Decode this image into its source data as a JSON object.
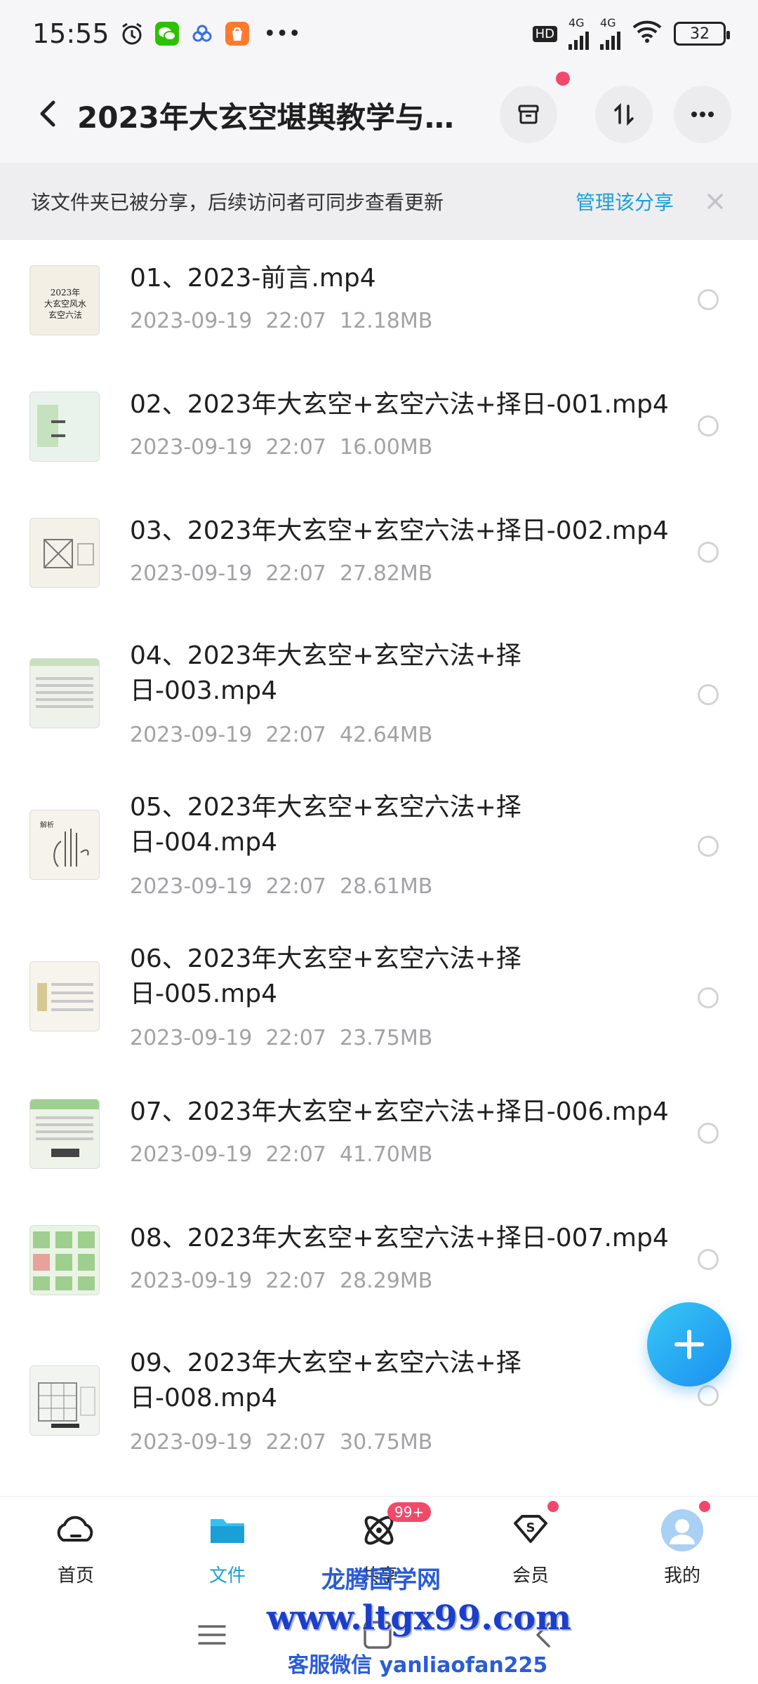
{
  "status": {
    "time": "15:55",
    "net1": "4G",
    "net2": "4G",
    "hd": "HD",
    "battery": "32",
    "more": "•••"
  },
  "header": {
    "title": "2023年大玄空堪舆教学与...",
    "icons": [
      "back-icon",
      "archive-icon",
      "sort-icon",
      "more-icon"
    ]
  },
  "banner": {
    "text": "该文件夹已被分享，后续访问者可同步查看更新",
    "manage": "管理该分享"
  },
  "files": [
    {
      "name": "01、2023-前言.mp4",
      "date": "2023-09-19",
      "time": "22:07",
      "size": "12.18MB"
    },
    {
      "name": "02、2023年大玄空+玄空六法+择日-001.mp4",
      "date": "2023-09-19",
      "time": "22:07",
      "size": "16.00MB"
    },
    {
      "name": "03、2023年大玄空+玄空六法+择日-002.mp4",
      "date": "2023-09-19",
      "time": "22:07",
      "size": "27.82MB"
    },
    {
      "name": "04、2023年大玄空+玄空六法+择日-003.mp4",
      "date": "2023-09-19",
      "time": "22:07",
      "size": "42.64MB"
    },
    {
      "name": "05、2023年大玄空+玄空六法+择日-004.mp4",
      "date": "2023-09-19",
      "time": "22:07",
      "size": "28.61MB"
    },
    {
      "name": "06、2023年大玄空+玄空六法+择日-005.mp4",
      "date": "2023-09-19",
      "time": "22:07",
      "size": "23.75MB"
    },
    {
      "name": "07、2023年大玄空+玄空六法+择日-006.mp4",
      "date": "2023-09-19",
      "time": "22:07",
      "size": "41.70MB"
    },
    {
      "name": "08、2023年大玄空+玄空六法+择日-007.mp4",
      "date": "2023-09-19",
      "time": "22:07",
      "size": "28.29MB"
    },
    {
      "name": "09、2023年大玄空+玄空六法+择日-008.mp4",
      "date": "2023-09-19",
      "time": "22:07",
      "size": "30.75MB"
    }
  ],
  "tabs": [
    {
      "label": "首页",
      "icon": "home-icon"
    },
    {
      "label": "文件",
      "icon": "folder-icon"
    },
    {
      "label": "共享",
      "icon": "share-icon",
      "badge": "99+"
    },
    {
      "label": "会员",
      "icon": "vip-icon"
    },
    {
      "label": "我的",
      "icon": "avatar-icon"
    }
  ],
  "watermark": {
    "line1": "龙腾国学网",
    "line2": "www.ltgx99.com",
    "line3": "客服微信 yanliaofan225"
  },
  "colors": {
    "accent": "#1a9fd9",
    "badge": "#f2496b",
    "fab": "#1a8ff0"
  }
}
